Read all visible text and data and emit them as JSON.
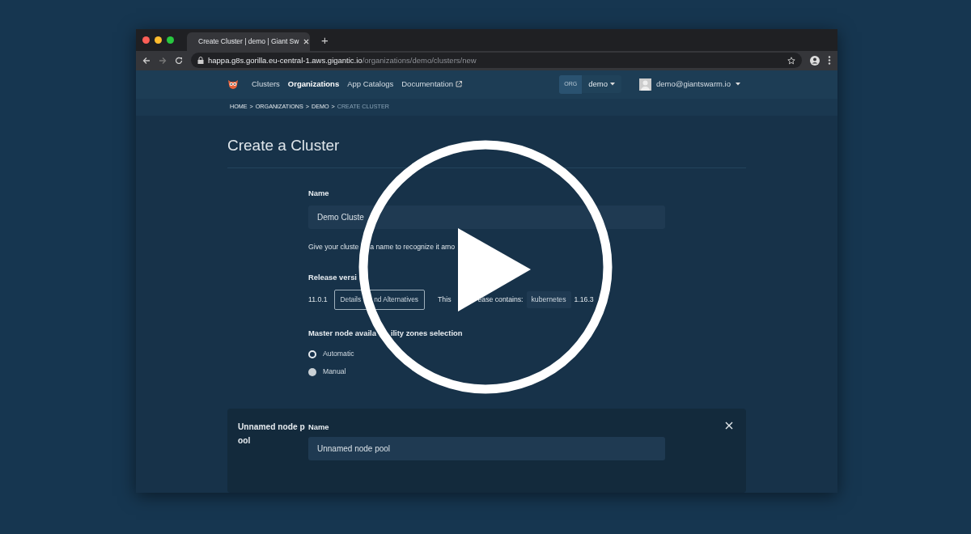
{
  "browser": {
    "tabs": [
      {
        "title": "Create Cluster | demo | Giant Sw",
        "selected": true
      }
    ],
    "new_tab": "+",
    "url": {
      "host": "happa.g8s.gorilla.eu-central-1.aws.gigantic.io",
      "path": "/organizations/demo/clusters/new"
    }
  },
  "navbar": {
    "items": [
      {
        "label": "Clusters",
        "selected": false,
        "external": false
      },
      {
        "label": "Organizations",
        "selected": true,
        "external": false
      },
      {
        "label": "App Catalogs",
        "selected": false,
        "external": false
      },
      {
        "label": "Documentation",
        "selected": false,
        "external": true
      }
    ],
    "org": {
      "badge": "ORG",
      "name": "demo"
    },
    "user": "demo@giantswarm.io"
  },
  "breadcrumb": {
    "separator": ">",
    "items": [
      {
        "label": "HOME",
        "selected": false
      },
      {
        "label": "ORGANIZATIONS",
        "selected": false
      },
      {
        "label": "DEMO",
        "selected": false
      },
      {
        "label": "CREATE CLUSTER",
        "selected": true
      }
    ]
  },
  "page_title": "Create a Cluster",
  "form": {
    "name_label": "Name",
    "name_value": "Demo Cluste",
    "name_help": [
      "Give your cluste",
      "a name to recognize it amo"
    ],
    "release_label": "Release versi",
    "release_version": "11.0.1",
    "details_button": [
      "Details",
      "nd Alternatives"
    ],
    "contains_label": [
      "This",
      "ease contains:"
    ],
    "components": [
      {
        "name": "kubernetes",
        "version": "1.16.3"
      }
    ],
    "az_label": [
      "Master node availa",
      "ility zones selection"
    ],
    "az_options": [
      {
        "label": "Automatic",
        "selected": true
      },
      {
        "label": "Manual",
        "selected": false
      }
    ]
  },
  "node_pool": {
    "title": "Unnamed node pool",
    "name_label": "Name",
    "name_value": "Unnamed node pool"
  }
}
